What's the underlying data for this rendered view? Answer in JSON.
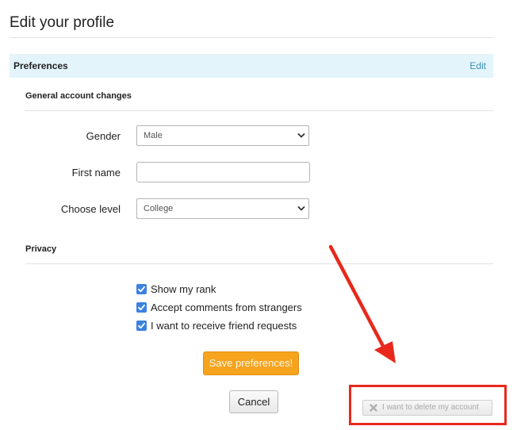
{
  "page_title": "Edit your profile",
  "preferences_bar": {
    "label": "Preferences",
    "edit_label": "Edit"
  },
  "general": {
    "heading": "General account changes",
    "gender": {
      "label": "Gender",
      "value": "Male"
    },
    "first_name": {
      "label": "First name",
      "value": "",
      "placeholder": ""
    },
    "level": {
      "label": "Choose level",
      "value": "College"
    }
  },
  "privacy": {
    "heading": "Privacy",
    "options": [
      {
        "label": "Show my rank",
        "checked": true
      },
      {
        "label": "Accept comments from strangers",
        "checked": true
      },
      {
        "label": "I want to receive friend requests",
        "checked": true
      }
    ]
  },
  "buttons": {
    "save": "Save preferences!",
    "cancel": "Cancel",
    "delete": "I want to delete my account"
  },
  "annotation": {
    "color": "#e8281c",
    "icon": "arrow-icon"
  },
  "colors": {
    "accent": "#f6a41e",
    "prefs_bar_bg": "#e3f4fb",
    "link": "#3b8fb3",
    "checkbox": "#3b82e0"
  }
}
